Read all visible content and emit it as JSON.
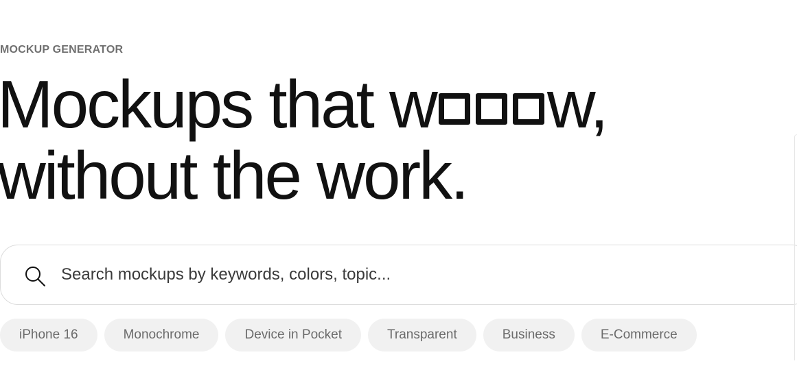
{
  "eyebrow": "MOCKUP GENERATOR",
  "headline": {
    "line1_prefix": "Mockups that w",
    "line1_suffix": "w,",
    "line2": "without the work."
  },
  "search": {
    "placeholder": "Search mockups by keywords, colors, topic...",
    "value": "",
    "icon": "search-icon"
  },
  "chips": [
    {
      "label": "iPhone 16"
    },
    {
      "label": "Monochrome"
    },
    {
      "label": "Device in Pocket"
    },
    {
      "label": "Transparent"
    },
    {
      "label": "Business"
    },
    {
      "label": "E-Commerce"
    }
  ],
  "colors": {
    "text": "#111111",
    "eyebrow": "#6f6f6f",
    "chip_bg": "#f1f1f1",
    "chip_text": "#6b6b6b",
    "border": "#dcdcdc"
  }
}
